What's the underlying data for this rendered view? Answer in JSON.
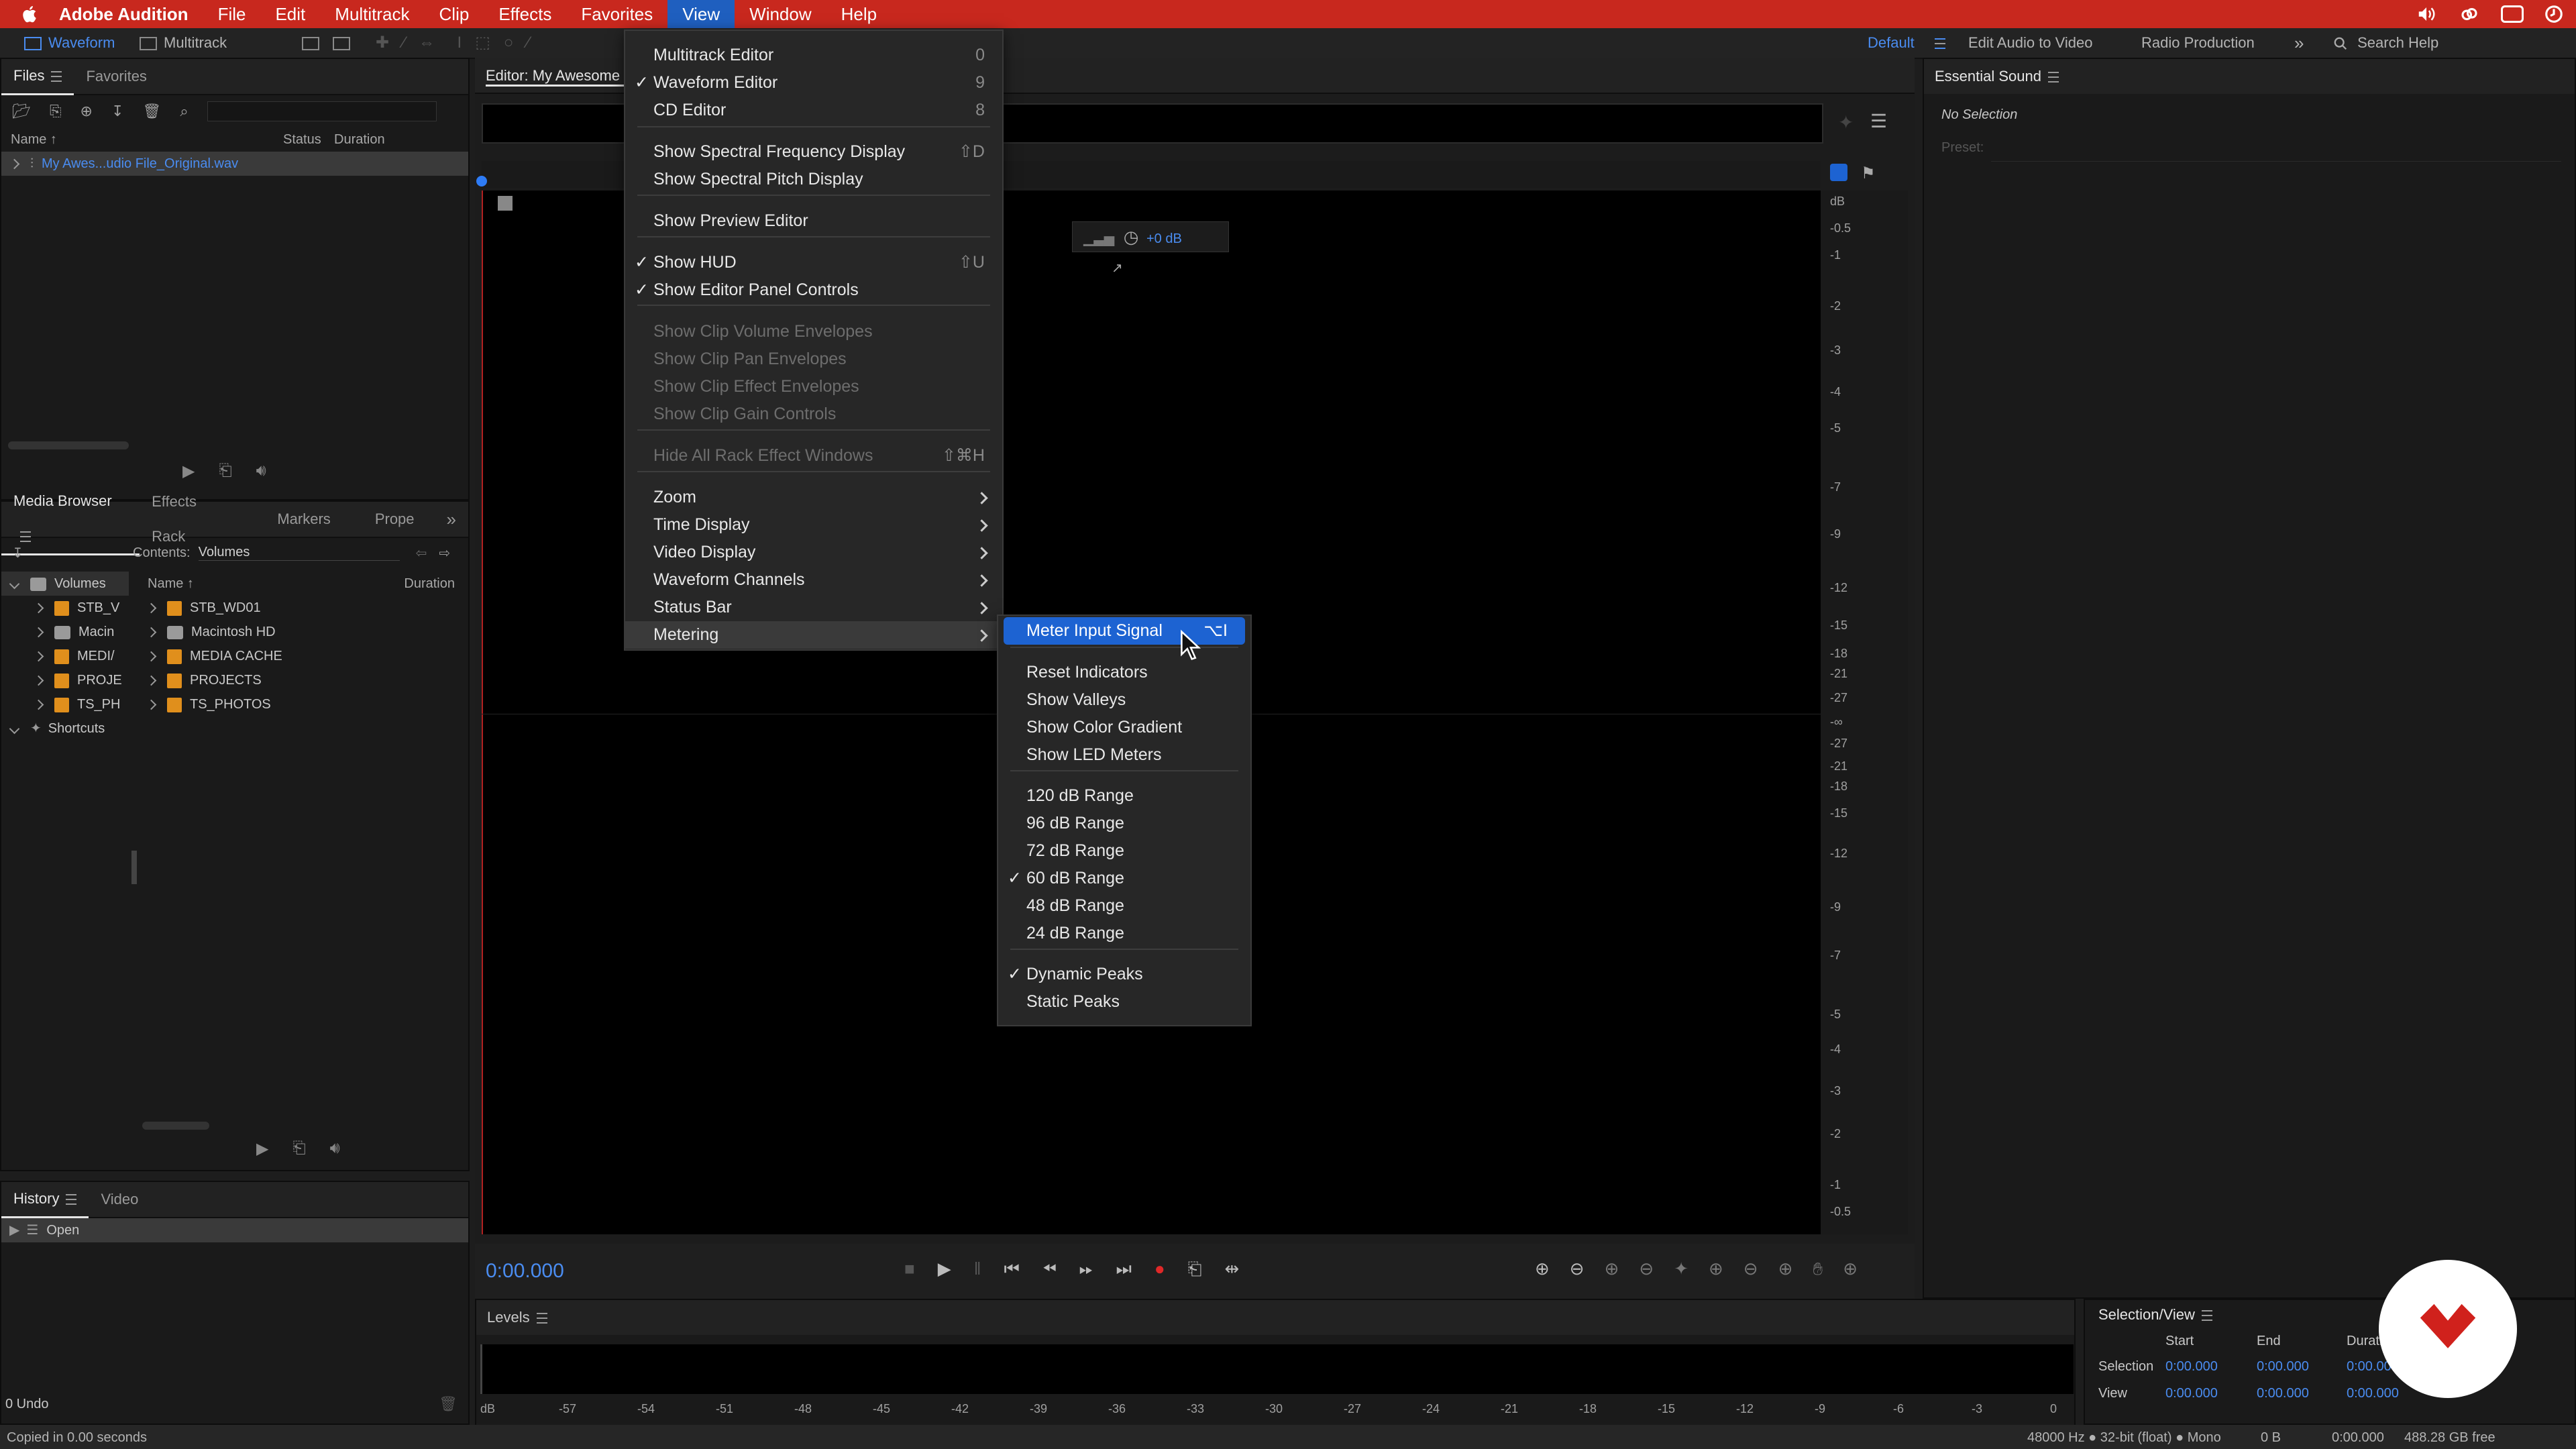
{
  "menubar": {
    "app": "Adobe Audition",
    "items": [
      "File",
      "Edit",
      "Multitrack",
      "Clip",
      "Effects",
      "Favorites",
      "View",
      "Window",
      "Help"
    ],
    "active": "View"
  },
  "toolbar": {
    "waveform": "Waveform",
    "multitrack": "Multitrack",
    "workspace_default": "Default",
    "workspace_edit_video": "Edit Audio to Video",
    "workspace_radio": "Radio Production",
    "search_placeholder": "Search Help"
  },
  "files_panel": {
    "tabs": [
      "Files",
      "Favorites"
    ],
    "columns": [
      "Name",
      "Status",
      "Duration"
    ],
    "file": "My Awes...udio File_Original.wav"
  },
  "media_browser": {
    "tabs": [
      "Media Browser",
      "Effects Rack",
      "Markers",
      "Prope"
    ],
    "contents_label": "Contents:",
    "contents_value": "Volumes",
    "tree": [
      "Volumes",
      "STB_V",
      "Macin",
      "MEDI/",
      "PROJE",
      "TS_PH",
      "Shortcuts"
    ],
    "columns": [
      "Name",
      "Duration"
    ],
    "items": [
      "STB_WD01",
      "Macintosh HD",
      "MEDIA CACHE",
      "PROJECTS",
      "TS_PHOTOS"
    ]
  },
  "history_panel": {
    "tabs": [
      "History",
      "Video"
    ],
    "item": "Open",
    "undo": "0 Undo"
  },
  "editor": {
    "tab": "Editor: My Awesome N",
    "hud_gain": "+0 dB",
    "time": "0:00.000",
    "db_label": "dB",
    "db_ticks": [
      "-0.5",
      "-1",
      "-2",
      "-3",
      "-4",
      "-5",
      "-7",
      "-9",
      "-12",
      "-15",
      "-18",
      "-21",
      "-27",
      "-∞",
      "-27",
      "-21",
      "-18",
      "-15",
      "-12",
      "-9",
      "-7",
      "-5",
      "-4",
      "-3",
      "-2",
      "-1",
      "-0.5"
    ]
  },
  "view_menu": {
    "items": [
      {
        "label": "Multitrack Editor",
        "shortcut": "0",
        "checked": false,
        "disabled": false
      },
      {
        "label": "Waveform Editor",
        "shortcut": "9",
        "checked": true,
        "disabled": false
      },
      {
        "label": "CD Editor",
        "shortcut": "8",
        "checked": false,
        "disabled": false
      },
      {
        "label": "Show Spectral Frequency Display",
        "shortcut": "⇧D",
        "checked": false,
        "disabled": false
      },
      {
        "label": "Show Spectral Pitch Display",
        "shortcut": "",
        "checked": false,
        "disabled": false
      },
      {
        "label": "Show Preview Editor",
        "shortcut": "",
        "checked": false,
        "disabled": false
      },
      {
        "label": "Show HUD",
        "shortcut": "⇧U",
        "checked": true,
        "disabled": false
      },
      {
        "label": "Show Editor Panel Controls",
        "shortcut": "",
        "checked": true,
        "disabled": false
      },
      {
        "label": "Show Clip Volume Envelopes",
        "shortcut": "",
        "checked": false,
        "disabled": true
      },
      {
        "label": "Show Clip Pan Envelopes",
        "shortcut": "",
        "checked": false,
        "disabled": true
      },
      {
        "label": "Show Clip Effect Envelopes",
        "shortcut": "",
        "checked": false,
        "disabled": true
      },
      {
        "label": "Show Clip Gain Controls",
        "shortcut": "",
        "checked": false,
        "disabled": true
      },
      {
        "label": "Hide All Rack Effect Windows",
        "shortcut": "⇧⌘H",
        "checked": false,
        "disabled": true
      },
      {
        "label": "Zoom",
        "submenu": true
      },
      {
        "label": "Time Display",
        "submenu": true
      },
      {
        "label": "Video Display",
        "submenu": true
      },
      {
        "label": "Waveform Channels",
        "submenu": true
      },
      {
        "label": "Status Bar",
        "submenu": true
      },
      {
        "label": "Metering",
        "submenu": true
      }
    ]
  },
  "metering_menu": {
    "items": [
      {
        "label": "Meter Input Signal",
        "shortcut": "⌥I",
        "checked": false
      },
      {
        "label": "Reset Indicators",
        "checked": false
      },
      {
        "label": "Show Valleys",
        "checked": false
      },
      {
        "label": "Show Color Gradient",
        "checked": false
      },
      {
        "label": "Show LED Meters",
        "checked": false
      },
      {
        "label": "120 dB Range",
        "checked": false
      },
      {
        "label": "96 dB Range",
        "checked": false
      },
      {
        "label": "72 dB Range",
        "checked": false
      },
      {
        "label": "60 dB Range",
        "checked": true
      },
      {
        "label": "48 dB Range",
        "checked": false
      },
      {
        "label": "24 dB Range",
        "checked": false
      },
      {
        "label": "Dynamic Peaks",
        "checked": true
      },
      {
        "label": "Static Peaks",
        "checked": false
      }
    ]
  },
  "essential_sound": {
    "title": "Essential Sound",
    "no_selection": "No Selection",
    "preset_label": "Preset:"
  },
  "levels": {
    "title": "Levels",
    "scale": [
      "dB",
      "-57",
      "-54",
      "-51",
      "-48",
      "-45",
      "-42",
      "-39",
      "-36",
      "-33",
      "-30",
      "-27",
      "-24",
      "-21",
      "-18",
      "-15",
      "-12",
      "-9",
      "-6",
      "-3",
      "0"
    ]
  },
  "selection_view": {
    "title": "Selection/View",
    "headers": [
      "Start",
      "End",
      "Durati"
    ],
    "rows": [
      {
        "label": "Selection",
        "start": "0:00.000",
        "end": "0:00.000",
        "duration": "0:00.000"
      },
      {
        "label": "View",
        "start": "0:00.000",
        "end": "0:00.000",
        "duration": "0:00.000"
      }
    ]
  },
  "status": {
    "left": "Copied in 0.00 seconds",
    "format": "48000 Hz ● 32-bit (float) ● Mono",
    "size": "0 B",
    "duration": "0:00.000",
    "free": "488.28 GB free"
  },
  "colors": {
    "menubar": "#c8281e",
    "accent": "#1d63d2",
    "link": "#4a8cf0"
  }
}
